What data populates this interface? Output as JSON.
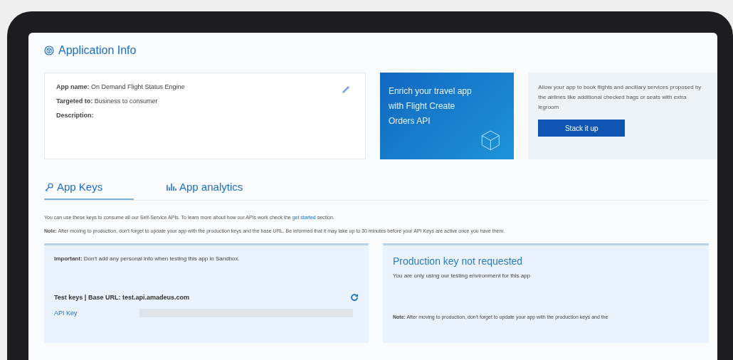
{
  "header": {
    "title": "Application Info"
  },
  "app_info": {
    "fields": [
      {
        "label": "App name:",
        "value": "On Demand Flight Status Engine"
      },
      {
        "label": "Targeted to:",
        "value": "Business to consumer"
      },
      {
        "label": "Description:"
      }
    ]
  },
  "promo": {
    "title": "Enrich your travel app with Flight Create Orders API",
    "description": "Allow your app to book flights and ancillary services proposed by the airlines like additional checked bags or seats with extra legroom",
    "button": "Stack it up"
  },
  "tabs": [
    {
      "label": "App Keys",
      "kind": "key",
      "selected": true
    },
    {
      "label": "App analytics",
      "kind": "analytics",
      "selected": false
    }
  ],
  "intro": {
    "before": "You can use these keys to consume all our Self-Service APIs. To learn more about how our APIs work check the",
    "link": "get started",
    "after": "section."
  },
  "note": "**Note:** After moving to production, don't forget to update your app with the production keys and the base URL. Be informed that it may take up to 30 minutes before your API Keys are active once you have them.",
  "test_panel": {
    "important": "**Important:** Don't add any personal info when testing this app in Sandbox.",
    "heading": "Test keys | Base URL: test.api.amadeus.com",
    "key_label": "API Key"
  },
  "production_panel": {
    "title": "Production key not requested",
    "subtitle": "You are only using our testing environment for this app",
    "note": "**Note:** After moving to production, don't forget to update your app with the production keys and the"
  }
}
